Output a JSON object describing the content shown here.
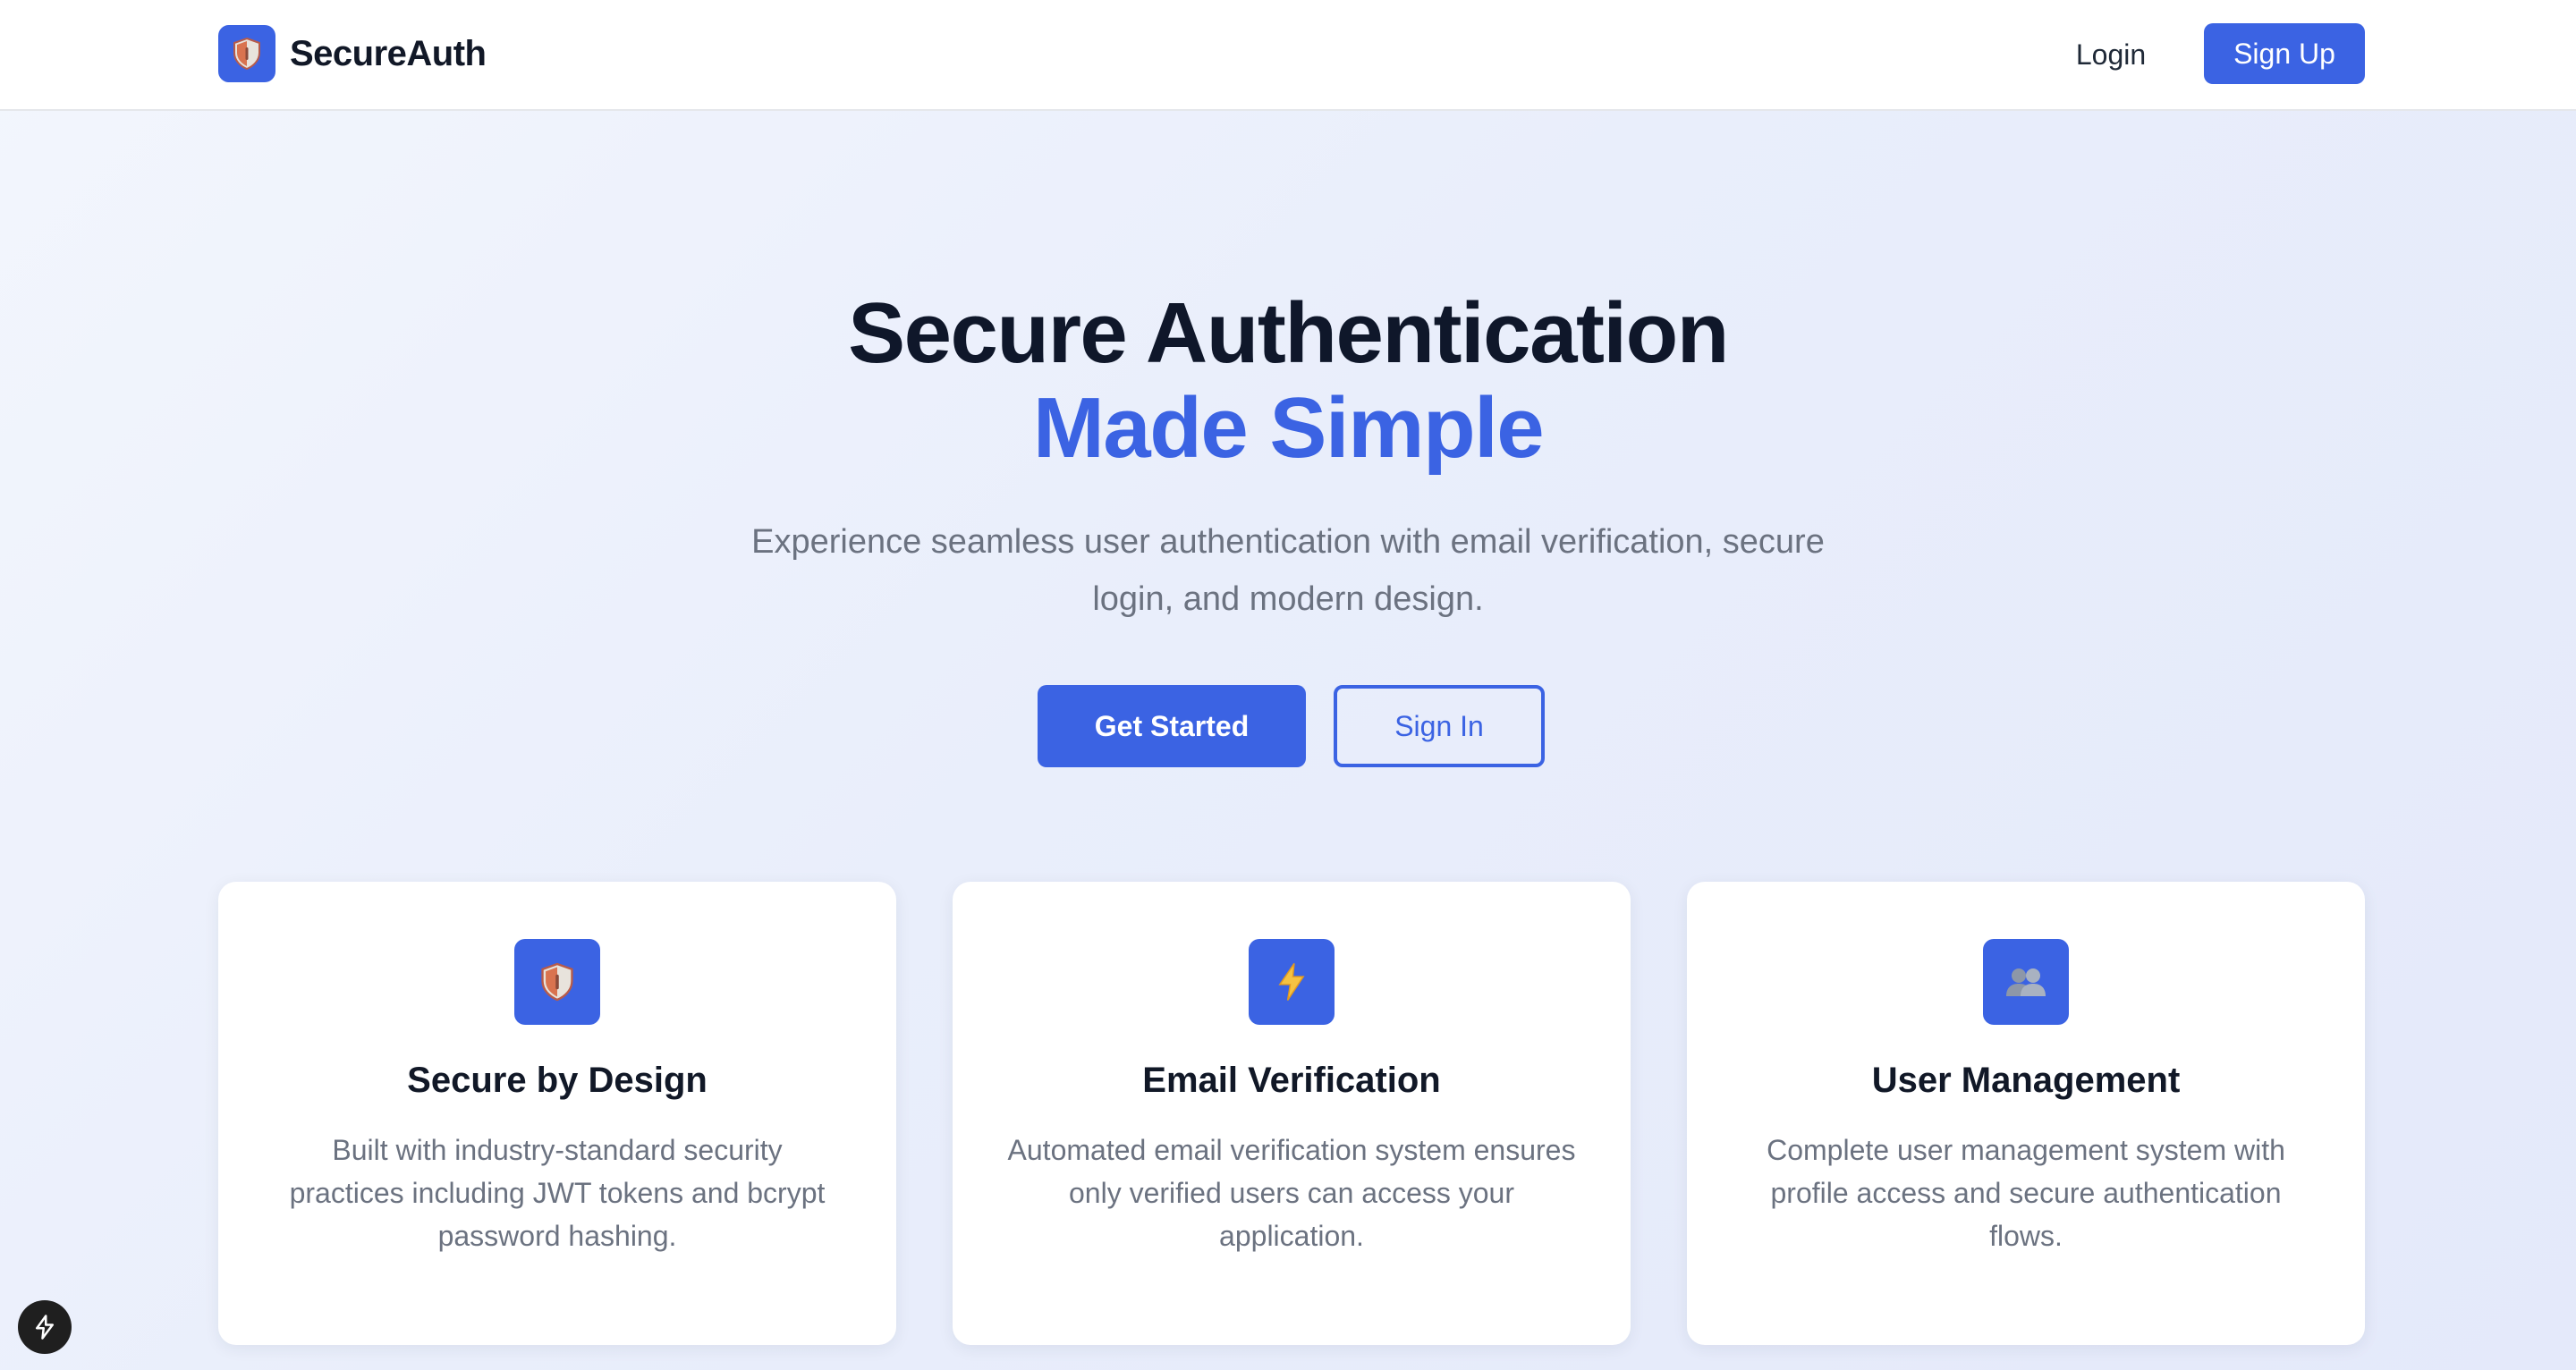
{
  "header": {
    "brand_name": "SecureAuth",
    "brand_icon": "shield-icon",
    "login_label": "Login",
    "signup_label": "Sign Up"
  },
  "hero": {
    "title_line1": "Secure Authentication",
    "title_line2": "Made Simple",
    "subtitle": "Experience seamless user authentication with email verification, secure login, and modern design.",
    "primary_cta": "Get Started",
    "secondary_cta": "Sign In"
  },
  "features": [
    {
      "icon": "shield-icon",
      "title": "Secure by Design",
      "description": "Built with industry-standard security practices including JWT tokens and bcrypt password hashing."
    },
    {
      "icon": "lightning-icon",
      "title": "Email Verification",
      "description": "Automated email verification system ensures only verified users can access your application."
    },
    {
      "icon": "users-icon",
      "title": "User Management",
      "description": "Complete user management system with profile access and secure authentication flows."
    }
  ],
  "colors": {
    "accent": "#3b63e3",
    "heading": "#0f172a",
    "muted": "#6b7280",
    "background": "#e9eefb"
  },
  "dev_indicator": {
    "icon": "lightning-bolt-icon"
  }
}
